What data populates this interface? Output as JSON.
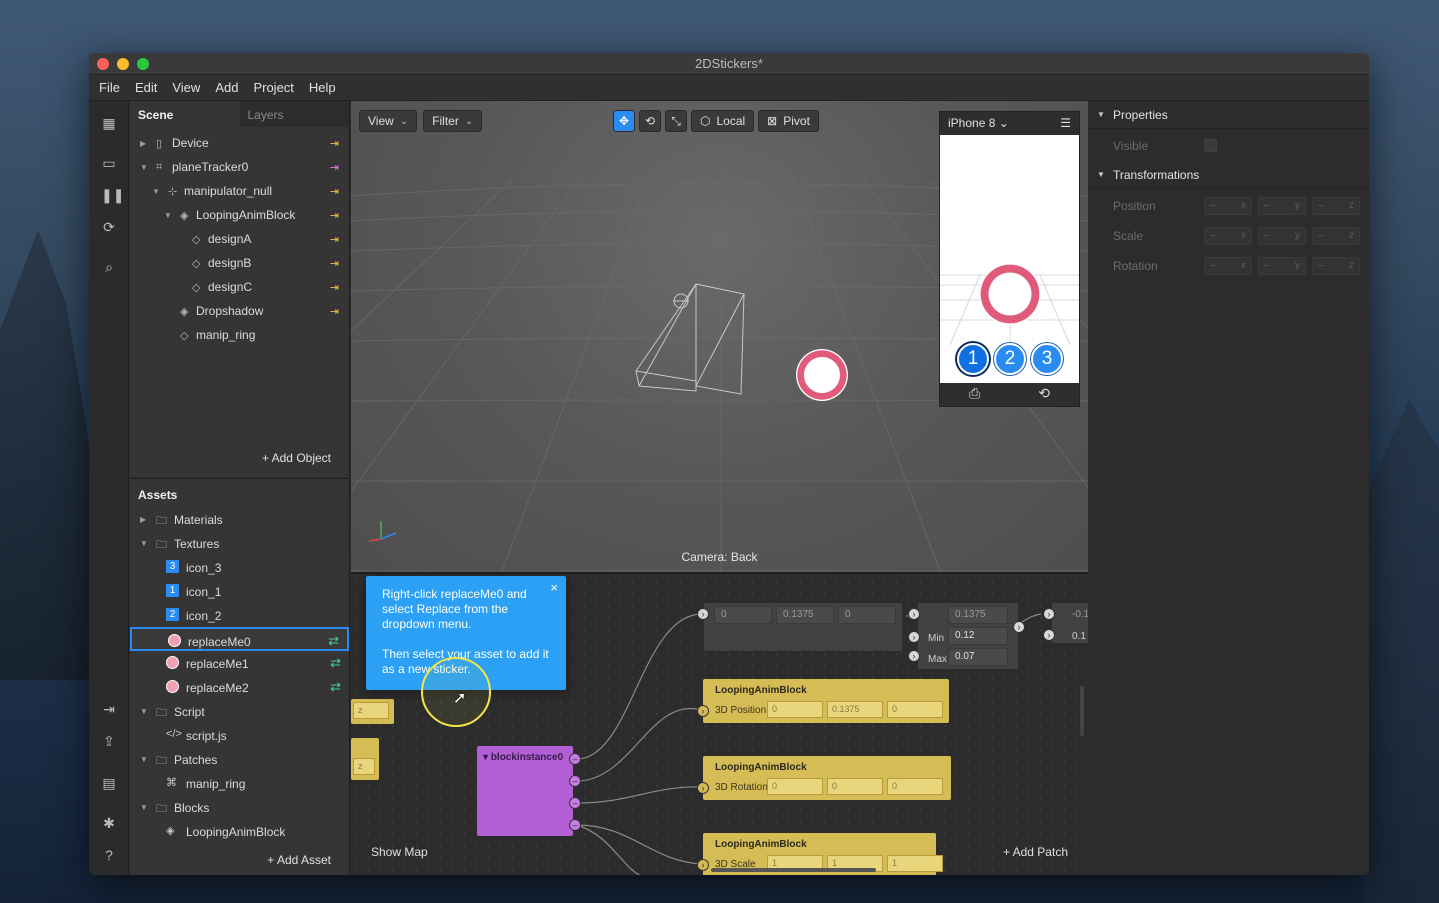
{
  "window": {
    "title": "2DStickers*"
  },
  "menu": [
    "File",
    "Edit",
    "View",
    "Add",
    "Project",
    "Help"
  ],
  "scene": {
    "tab_active": "Scene",
    "tab_inactive": "Layers",
    "items": [
      {
        "label": "Device",
        "indent": 0,
        "arrow": "▶",
        "icon": "▯"
      },
      {
        "label": "planeTracker0",
        "indent": 0,
        "arrow": "▼",
        "icon": "⌗"
      },
      {
        "label": "manipulator_null",
        "indent": 1,
        "arrow": "▼",
        "icon": "⊹"
      },
      {
        "label": "LoopingAnimBlock",
        "indent": 2,
        "arrow": "▼",
        "icon": "◈"
      },
      {
        "label": "designA",
        "indent": 3,
        "arrow": "",
        "icon": "◇"
      },
      {
        "label": "designB",
        "indent": 3,
        "arrow": "",
        "icon": "◇"
      },
      {
        "label": "designC",
        "indent": 3,
        "arrow": "",
        "icon": "◇"
      },
      {
        "label": "Dropshadow",
        "indent": 2,
        "arrow": "",
        "icon": "◈"
      },
      {
        "label": "manip_ring",
        "indent": 2,
        "arrow": "",
        "icon": "◇"
      }
    ],
    "add_object": "+  Add Object"
  },
  "assets": {
    "title": "Assets",
    "items": [
      {
        "label": "Materials",
        "indent": 0,
        "arrow": "▶",
        "icon": "folder"
      },
      {
        "label": "Textures",
        "indent": 0,
        "arrow": "▼",
        "icon": "folder"
      },
      {
        "label": "icon_3",
        "indent": 1,
        "badge": "3"
      },
      {
        "label": "icon_1",
        "indent": 1,
        "badge": "1"
      },
      {
        "label": "icon_2",
        "indent": 1,
        "badge": "2"
      },
      {
        "label": "replaceMe0",
        "indent": 1,
        "sticker": true,
        "swap": true,
        "selected": true
      },
      {
        "label": "replaceMe1",
        "indent": 1,
        "sticker": true,
        "swap": true
      },
      {
        "label": "replaceMe2",
        "indent": 1,
        "sticker": true,
        "swap": true
      },
      {
        "label": "Script",
        "indent": 0,
        "arrow": "▼",
        "icon": "folder"
      },
      {
        "label": "script.js",
        "indent": 1,
        "icon": "</>"
      },
      {
        "label": "Patches",
        "indent": 0,
        "arrow": "▼",
        "icon": "folder"
      },
      {
        "label": "manip_ring",
        "indent": 1,
        "icon": "⌘"
      },
      {
        "label": "Blocks",
        "indent": 0,
        "arrow": "▼",
        "icon": "folder"
      },
      {
        "label": "LoopingAnimBlock",
        "indent": 1,
        "icon": "◈"
      }
    ],
    "add_asset": "+  Add Asset"
  },
  "viewport": {
    "view": "View",
    "filter": "Filter",
    "local": "Local",
    "pivot": "Pivot",
    "camera": "Camera: Back"
  },
  "phone": {
    "device": "iPhone 8",
    "buttons": [
      "1",
      "2",
      "3"
    ]
  },
  "properties": {
    "section1": "Properties",
    "visible": "Visible",
    "section2": "Transformations",
    "rows": [
      "Position",
      "Scale",
      "Rotation"
    ],
    "vec_axes": [
      "x",
      "y",
      "z"
    ],
    "vec_placeholder": "–"
  },
  "patch": {
    "top_fields": [
      "0",
      "0.1375",
      "0"
    ],
    "right_value": "0.1375",
    "min_label": "Min",
    "min_value": "0.12",
    "max_label": "Max",
    "max_value": "0.07",
    "far_value": "-0.1",
    "far_value2": "0.1",
    "nodes": [
      {
        "title": "LoopingAnimBlock",
        "port": "3D Position",
        "fields": [
          "0",
          "0.1375",
          "0"
        ]
      },
      {
        "title": "LoopingAnimBlock",
        "port": "3D Rotation",
        "fields": [
          "0",
          "0",
          "0"
        ]
      },
      {
        "title": "LoopingAnimBlock",
        "port": "3D Scale",
        "fields": [
          "1",
          "1",
          "1"
        ]
      }
    ],
    "block_instance": "blockinstance0",
    "show_map": "Show Map",
    "add_patch": "+  Add Patch"
  },
  "tooltip": {
    "line1": "Right-click replaceMe0 and select Replace from the dropdown menu.",
    "line2": "Then select your asset to add it as a new sticker.",
    "close": "×"
  }
}
